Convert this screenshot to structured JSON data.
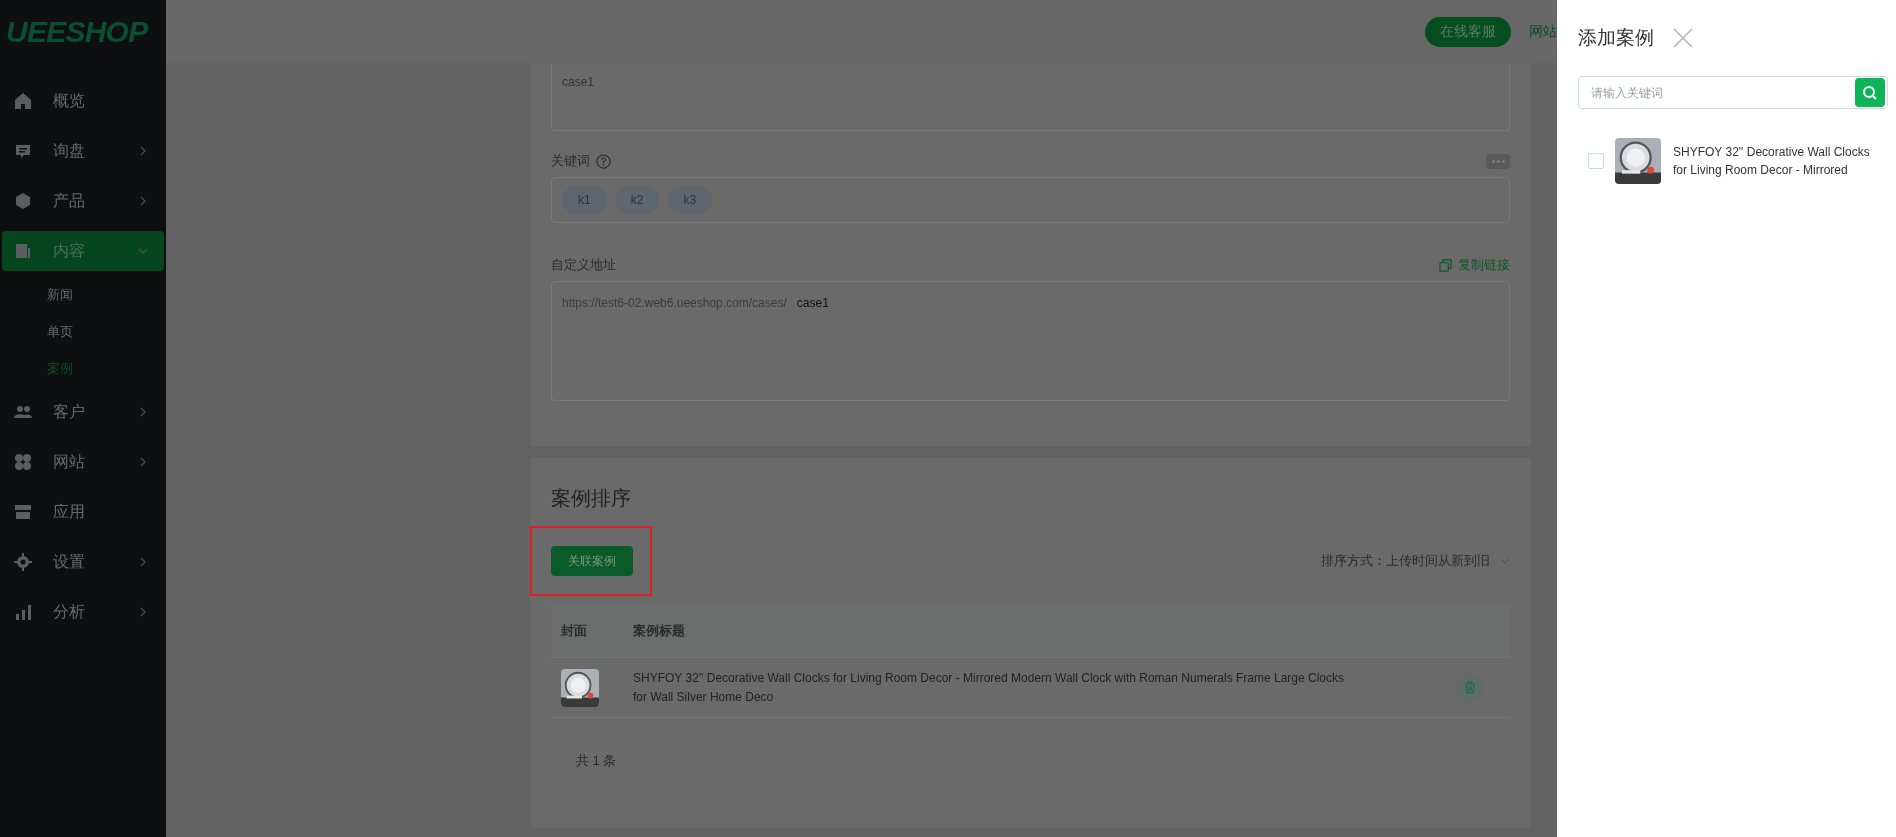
{
  "sidebar": {
    "logo": "UEESHOP",
    "items": [
      {
        "label": "概览",
        "selected": false
      },
      {
        "label": "询盘",
        "selected": false,
        "expanded": false
      },
      {
        "label": "产品",
        "selected": false,
        "expanded": false
      },
      {
        "label": "内容",
        "selected": true,
        "expanded": true,
        "children": [
          {
            "label": "新闻",
            "selected": false
          },
          {
            "label": "单页",
            "selected": false
          },
          {
            "label": "案例",
            "selected": true
          }
        ]
      },
      {
        "label": "客户",
        "selected": false,
        "expanded": false
      },
      {
        "label": "网站",
        "selected": false,
        "expanded": false
      },
      {
        "label": "应用",
        "selected": false
      },
      {
        "label": "设置",
        "selected": false,
        "expanded": false
      },
      {
        "label": "分析",
        "selected": false,
        "expanded": false
      }
    ]
  },
  "header": {
    "service_button": "在线客服",
    "link": "网站"
  },
  "form": {
    "name_value": "case1",
    "keywords": {
      "label": "关键词",
      "tags": [
        "k1",
        "k2",
        "k3"
      ]
    },
    "url": {
      "label": "自定义地址",
      "copy_link": "复制链接",
      "prefix": "https://test6-02.web6.ueeshop.com/cases/",
      "value": "case1"
    }
  },
  "sorting": {
    "title": "案例排序",
    "button": "关联案例",
    "sort_label": "排序方式：上传时间从新到旧",
    "table": {
      "columns": [
        "封面",
        "案例标题"
      ],
      "rows": [
        {
          "title": "SHYFOY 32'' Decorative Wall Clocks for Living Room Decor - Mirrored Modern Wall Clock with Roman Numerals Frame Large Clocks for Wall Silver Home Deco"
        }
      ]
    },
    "total": "共 1 条"
  },
  "drawer": {
    "title": "添加案例",
    "search": {
      "placeholder": "请输入关键词"
    },
    "items": [
      {
        "title": "SHYFOY 32'' Decorative Wall Clocks for Living Room Decor - Mirrored",
        "checked": false
      }
    ]
  }
}
